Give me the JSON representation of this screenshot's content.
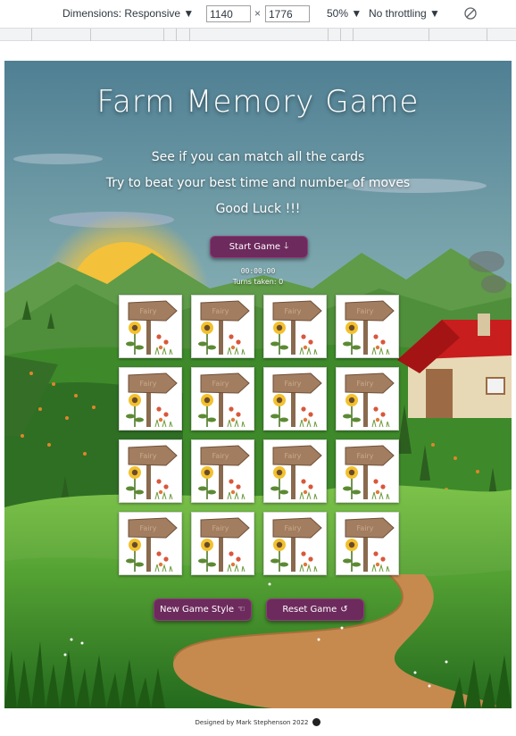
{
  "devtools": {
    "dimensions_label": "Dimensions: Responsive ▼",
    "width_value": "1140",
    "height_value": "1776",
    "times_symbol": "×",
    "zoom_label": "50% ▼",
    "throttle_label": "No throttling ▼",
    "rotate_icon": "rotate-icon"
  },
  "game": {
    "title": "Farm Memory Game",
    "intro_lines": [
      "See if you can match all the cards",
      "Try to beat your best time and number of moves",
      "Good Luck !!!"
    ],
    "start_button": {
      "label": "Start Game",
      "icon": "arrow-down-icon",
      "glyph": "🡓"
    },
    "timer": "00:00:00",
    "turns_label": "Turns taken: 0",
    "cards": {
      "rows": 4,
      "cols": 4,
      "back_image": "signpost-sunflower-card-back",
      "sign_text": "Fairy"
    },
    "new_game_button": {
      "label": "New Game Style",
      "icon": "hand-pointer-icon",
      "glyph": "☜"
    },
    "reset_button": {
      "label": "Reset Game",
      "icon": "rotate-left-icon",
      "glyph": "↺"
    }
  },
  "footer": {
    "credit": "Designed by Mark Stephenson 2022",
    "icon": "github-icon"
  },
  "colors": {
    "button": "#6d2a5d",
    "sky": "#5b8d9e",
    "grass": "#3e8a2a"
  }
}
